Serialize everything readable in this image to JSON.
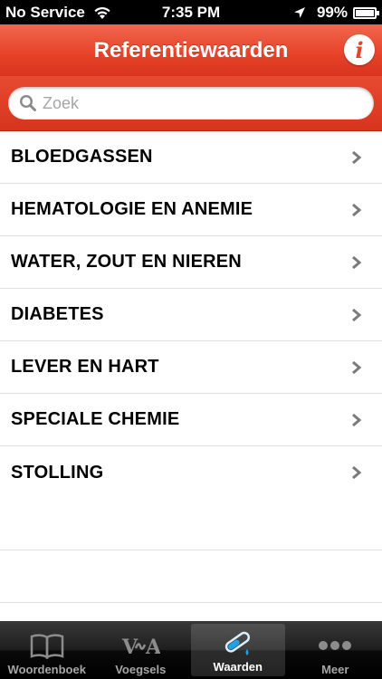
{
  "status": {
    "carrier": "No Service",
    "time": "7:35 PM",
    "battery": "99%",
    "battery_level": 0.99
  },
  "nav": {
    "title": "Referentiewaarden",
    "info_label": "i"
  },
  "search": {
    "placeholder": "Zoek",
    "value": ""
  },
  "list": {
    "items": [
      {
        "label": "BLOEDGASSEN"
      },
      {
        "label": "HEMATOLOGIE EN ANEMIE"
      },
      {
        "label": "WATER, ZOUT EN NIEREN"
      },
      {
        "label": "DIABETES"
      },
      {
        "label": "LEVER EN HART"
      },
      {
        "label": "SPECIALE CHEMIE"
      },
      {
        "label": "STOLLING"
      }
    ]
  },
  "tabs": [
    {
      "label": "Woordenboek",
      "icon": "book-icon",
      "active": false
    },
    {
      "label": "Voegsels",
      "icon": "voegsels-icon",
      "active": false
    },
    {
      "label": "Waarden",
      "icon": "test-tube-icon",
      "active": true
    },
    {
      "label": "Meer",
      "icon": "more-dots-icon",
      "active": false
    }
  ],
  "colors": {
    "accent": "#e8442c",
    "tabbar": "#1e1e1e"
  }
}
